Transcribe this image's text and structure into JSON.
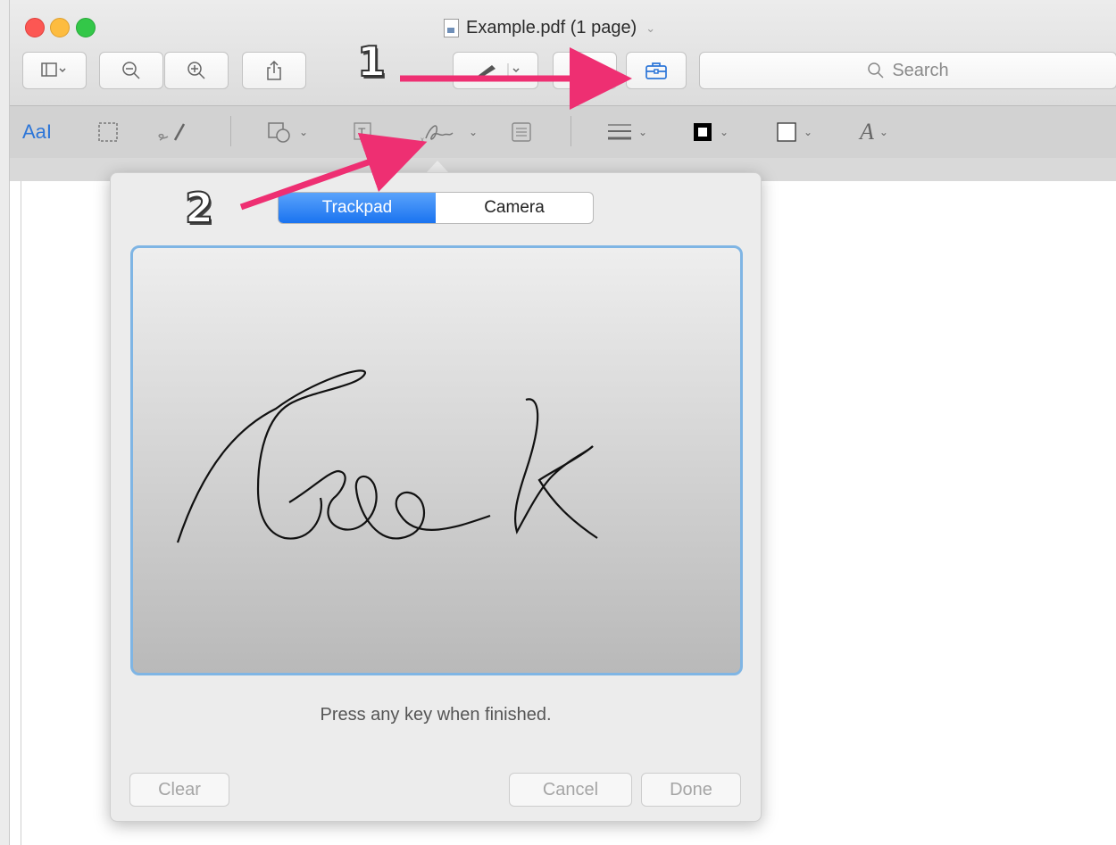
{
  "window": {
    "title": "Example.pdf (1 page)"
  },
  "toolbar": {
    "search_placeholder": "Search"
  },
  "annotations": {
    "step1": "1",
    "step2": "2",
    "arrow_color": "#ee2f72"
  },
  "signature_popover": {
    "tabs": [
      {
        "label": "Trackpad",
        "active": true
      },
      {
        "label": "Camera",
        "active": false
      }
    ],
    "hint": "Press any key when finished.",
    "buttons": {
      "clear": "Clear",
      "cancel": "Cancel",
      "done": "Done"
    }
  },
  "colors": {
    "accent_blue": "#1a73f0",
    "pad_border": "#7fb5e4",
    "close": "#fc5753",
    "minimize": "#fdbc40",
    "zoom": "#33c748"
  },
  "icons": [
    "sidebar-icon",
    "zoom-out-icon",
    "zoom-in-icon",
    "share-icon",
    "pen-icon",
    "rotate-icon",
    "toolbox-icon",
    "search-icon",
    "text-style-icon",
    "rect-selection-icon",
    "sketch-icon",
    "shapes-icon",
    "textbox-icon",
    "signature-icon",
    "note-icon",
    "line-style-icon",
    "border-color-icon",
    "fill-color-icon",
    "font-icon"
  ]
}
